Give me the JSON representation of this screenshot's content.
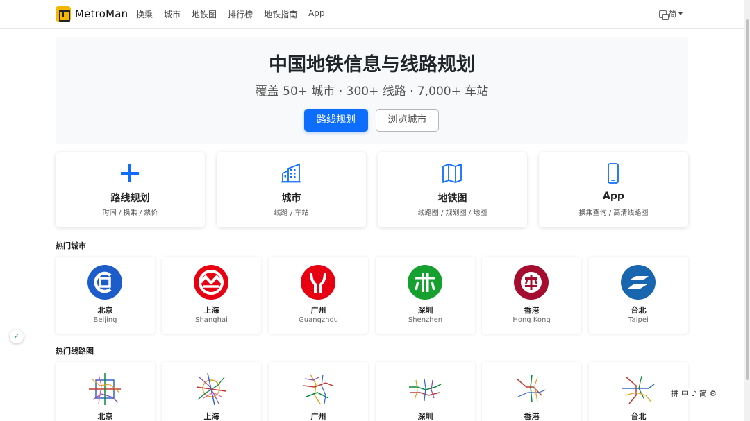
{
  "nav": {
    "brand": "MetroMan",
    "links": [
      "换乘",
      "城市",
      "地铁图",
      "排行榜",
      "地铁指南",
      "App"
    ],
    "lang": "简"
  },
  "hero": {
    "title": "中国地铁信息与线路规划",
    "subtitle": "覆盖 50+ 城市 · 300+ 线路 · 7,000+ 车站",
    "primary_button": "路线规划",
    "secondary_button": "浏览城市"
  },
  "features": [
    {
      "title": "路线规划",
      "desc": "时间 / 换乘 / 票价",
      "icon": "plus-icon"
    },
    {
      "title": "城市",
      "desc": "线路 / 车站",
      "icon": "buildings-icon"
    },
    {
      "title": "地铁图",
      "desc": "线路图 / 规划图 / 地图",
      "icon": "map-icon"
    },
    {
      "title": "App",
      "desc": "换乘查询 / 高清线路图",
      "icon": "phone-icon"
    }
  ],
  "sections": {
    "popular_cities": "热门城市",
    "popular_maps": "热门线路图"
  },
  "cities": [
    {
      "name": "北京",
      "en": "Beijing",
      "color": "#1d5dc9"
    },
    {
      "name": "上海",
      "en": "Shanghai",
      "color": "#e60012"
    },
    {
      "name": "广州",
      "en": "Guangzhou",
      "color": "#e60012"
    },
    {
      "name": "深圳",
      "en": "Shenzhen",
      "color": "#16a030"
    },
    {
      "name": "香港",
      "en": "Hong Kong",
      "color": "#a50d30"
    },
    {
      "name": "台北",
      "en": "Taipei",
      "color": "#1966b0"
    }
  ],
  "maps": [
    "北京",
    "上海",
    "广州",
    "深圳",
    "香港",
    "台北"
  ],
  "ime": [
    "拼",
    "中",
    "♪",
    "简"
  ],
  "accent_color": "#0d6efd"
}
